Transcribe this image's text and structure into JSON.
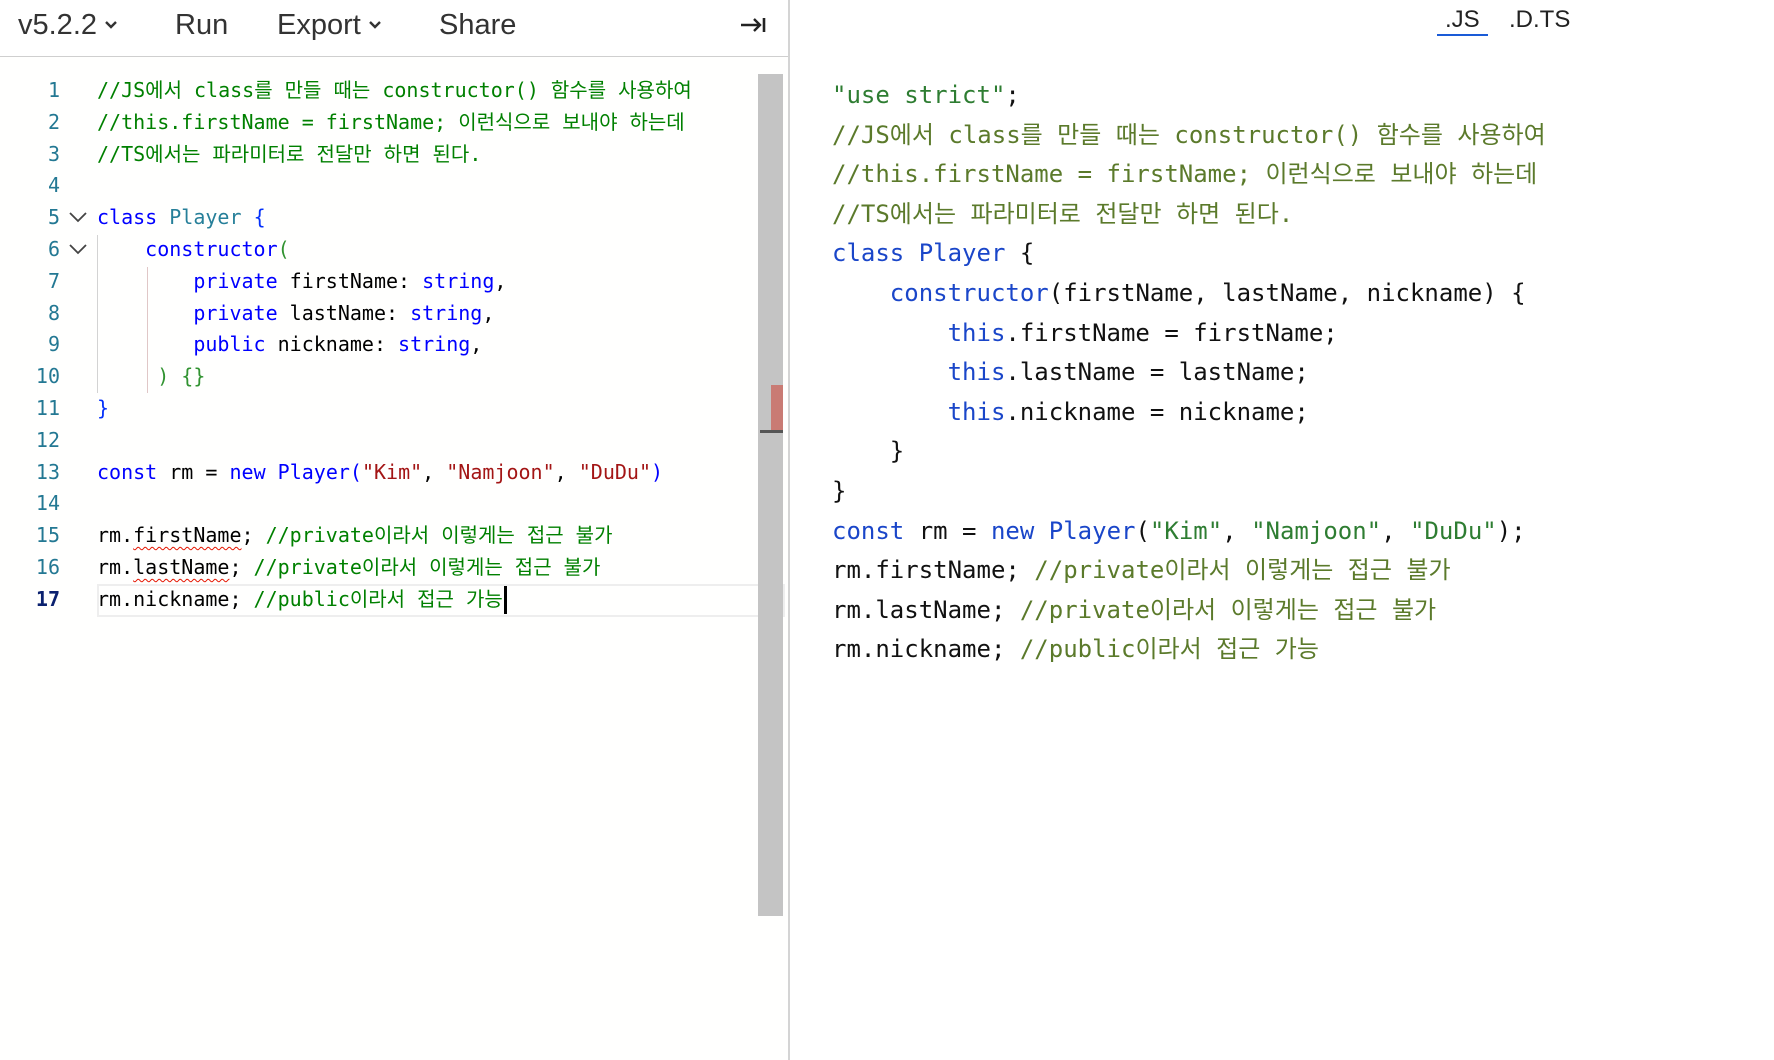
{
  "toolbar": {
    "version_label": "v5.2.2",
    "run_label": "Run",
    "export_label": "Export",
    "share_label": "Share",
    "collapse_icon": "arrow-right-to-bar-icon"
  },
  "editor": {
    "line_numbers": [
      "1",
      "2",
      "3",
      "4",
      "5",
      "6",
      "7",
      "8",
      "9",
      "10",
      "11",
      "12",
      "13",
      "14",
      "15",
      "16",
      "17"
    ],
    "active_line": 17,
    "lines": {
      "l1": "//JS에서 class를 만들 때는 constructor() 함수를 사용하여",
      "l2": "//this.firstName = firstName; 이런식으로 보내야 하는데",
      "l3": "//TS에서는 파라미터로 전달만 하면 된다.",
      "l5_kw": "class",
      "l5_name": "Player",
      "l5_brace": "{",
      "l6_ctor": "constructor",
      "l6_paren": "(",
      "l7_mod": "private",
      "l7_name": "firstName",
      "l7_type": "string",
      "l8_mod": "private",
      "l8_name": "lastName",
      "l8_type": "string",
      "l9_mod": "public",
      "l9_name": "nickname",
      "l9_type": "string",
      "l10": ") {}",
      "l11": "}",
      "l13_const": "const",
      "l13_var": "rm",
      "l13_new": "new",
      "l13_cls": "Player",
      "l13_a1": "\"Kim\"",
      "l13_a2": "\"Namjoon\"",
      "l13_a3": "\"DuDu\"",
      "l15_prop": "firstName",
      "l15_cm": "//private이라서 이렇게는 접근 불가",
      "l16_prop": "lastName",
      "l16_cm": "//private이라서 이렇게는 접근 불가",
      "l17_prop": "nickname",
      "l17_cm": "//public이라서 접근 가능"
    }
  },
  "output": {
    "tab_js": ".JS",
    "tab_dts": ".D.TS",
    "active_tab": ".JS",
    "lines": {
      "o1": "\"use strict\"",
      "o2": "//JS에서 class를 만들 때는 constructor() 함수를 사용하여",
      "o3": "//this.firstName = firstName; 이런식으로 보내야 하는데",
      "o4": "//TS에서는 파라미터로 전달만 하면 된다.",
      "o5_kw": "class",
      "o5_name": "Player",
      "o6_ctor": "constructor",
      "o6_params": "(firstName, lastName, nickname) {",
      "o7": ".firstName = firstName;",
      "o8": ".lastName = lastName;",
      "o9": ".nickname = nickname;",
      "this_kw": "this",
      "o10": "}",
      "o11": "}",
      "o12_const": "const",
      "o12_new": "new",
      "o12_cls": "Player",
      "o12_a1": "\"Kim\"",
      "o12_a2": "\"Namjoon\"",
      "o12_a3": "\"DuDu\"",
      "o13_cm": "//private이라서 이렇게는 접근 불가",
      "o14_cm": "//private이라서 이렇게는 접근 불가",
      "o15_cm": "//public이라서 접근 가능"
    }
  },
  "colors": {
    "comment": "#008000",
    "keyword": "#0000ff",
    "string": "#a31515",
    "type": "#267f99",
    "line_number": "#237893",
    "error_squiggle": "#e51400",
    "js_tab_underline": "#1a5bd7"
  }
}
